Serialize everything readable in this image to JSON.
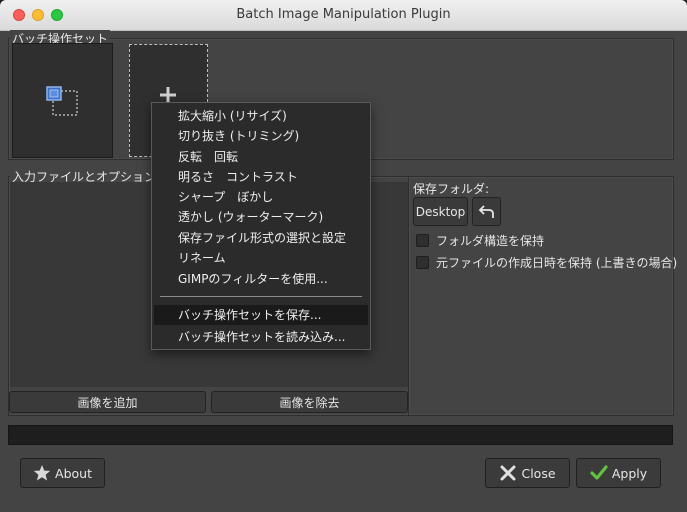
{
  "window": {
    "title": "Batch Image Manipulation Plugin"
  },
  "operations_frame": {
    "label": "バッチ操作セット"
  },
  "input_frame": {
    "label": "入力ファイルとオプション",
    "add_button": "画像を追加",
    "remove_button": "画像を除去"
  },
  "save_folder": {
    "label": "保存フォルダ:",
    "folder_button": "Desktop",
    "option1": "フォルダ構造を保持",
    "option2": "元ファイルの作成日時を保持 (上書きの場合)"
  },
  "footer": {
    "about": "About",
    "close": "Close",
    "apply": "Apply"
  },
  "menu": {
    "items": [
      "拡大縮小 (リサイズ)",
      "切り抜き (トリミング)",
      "反転　回転",
      "明るさ　コントラスト",
      "シャープ　ぼかし",
      "透かし (ウォーターマーク)",
      "保存ファイル形式の選択と設定",
      "リネーム",
      "GIMPのフィルターを使用..."
    ],
    "save_set": "バッチ操作セットを保存...",
    "load_set": "バッチ操作セットを読み込み..."
  },
  "icons": {
    "resize": "resize-icon",
    "add": "plus-icon",
    "undo": "undo-arrow-icon",
    "about": "star-icon",
    "close": "x-icon",
    "apply": "checkmark-icon"
  },
  "colors": {
    "accent_blue": "#4a7fd6",
    "apply_check": "#63c43a"
  }
}
